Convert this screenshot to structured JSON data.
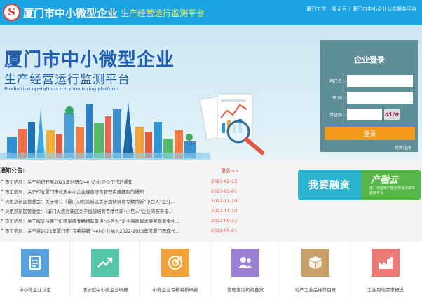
{
  "header": {
    "logo_glyph": "S",
    "title": "厦门市中小微型企业",
    "subtitle": "生产经营运行监测平台",
    "links": [
      {
        "label": "厦门工信"
      },
      {
        "label": "昝企云"
      },
      {
        "label": "厦门市中小企业公共服务平台"
      }
    ],
    "link_separator": "|"
  },
  "banner": {
    "title": "厦门市中小微型企业",
    "subtitle": "生产经营运行监测平台",
    "subtitle_en": "Production operations run monitoring platform"
  },
  "login": {
    "title": "企业登录",
    "username_label": "用户名 :",
    "password_label": "密 码 :",
    "captcha_label": "验证码 :",
    "captcha_value": "8570",
    "submit_label": "登录",
    "forgot_label": "免费注册"
  },
  "notices": {
    "title": "通知公告:",
    "more": "更多>>",
    "items": [
      {
        "text": "市工信局：关于组织开展2023年创新型中小企业评价工作的通知",
        "date": "2023-02-15"
      },
      {
        "text": "市工信局：关于印发厦门市优质中小企业梯度培育管理实施细则的通知",
        "date": "2023-02-01"
      },
      {
        "text": "火炬高新区管委会：关于修订《厦门火炬高新区关于加快培育专精特新“小巨人”企业...",
        "date": "2022-11-10"
      },
      {
        "text": "火炬高新区管委会：《厦门火炬高新区关于加快培育专精特新“小巨人”企业的若干措...",
        "date": "2022-11-10"
      },
      {
        "text": "市工信局：关于拟支持第三批国家级专精特新重点“小巨人”企业高质量发展奖励资金补...",
        "date": "2022-09-23"
      },
      {
        "text": "市工信局：关于将2022年厦门市“专精特新”中小企业纳入2022-2023年度厦门市成长...",
        "date": "2022-09-21"
      }
    ]
  },
  "finance": {
    "left_label": "我要融资",
    "right_title": "产融云",
    "right_desc": "厦门市国家产融合作试点城市服务平台"
  },
  "services": [
    {
      "label": "中小微企业认定",
      "icon": "document-icon",
      "color": "#5aa2dc"
    },
    {
      "label": "成长型中小微企业申报",
      "icon": "trend-chart-icon",
      "color": "#53c6a9"
    },
    {
      "label": "小微企业专精特新申报",
      "icon": "target-icon",
      "color": "#f0a33a"
    },
    {
      "label": "管理咨询机构备案",
      "icon": "users-icon",
      "color": "#9b7fd4"
    },
    {
      "label": "地产工业品推荐目录",
      "icon": "box-icon",
      "color": "#c8a06a"
    },
    {
      "label": "工业用地需求报送",
      "icon": "factory-icon",
      "color": "#ec7b76"
    }
  ]
}
